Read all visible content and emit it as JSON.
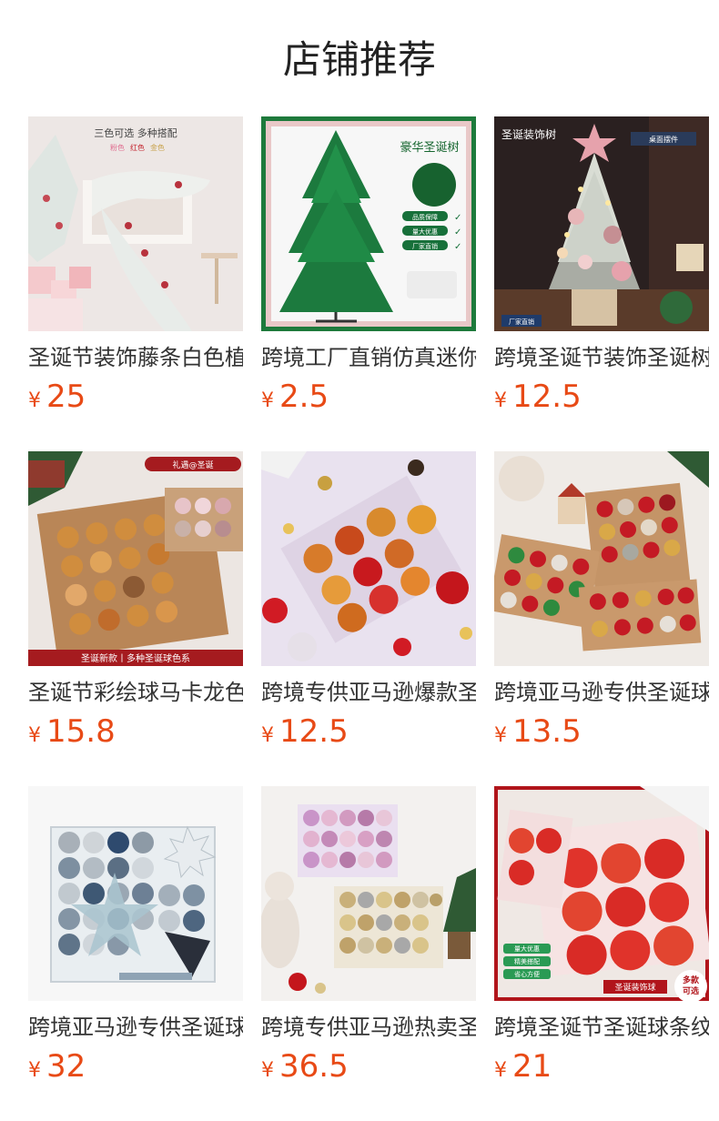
{
  "section_title": "店铺推荐",
  "currency_symbol": "¥",
  "products": [
    {
      "name": "圣诞节装饰藤条白色植绒",
      "price": "25",
      "image_tags": [
        "三色可选",
        "多种搭配",
        "粉色",
        "红色",
        "金色"
      ]
    },
    {
      "name": "跨境工厂直销仿真迷你圣诞树",
      "price": "2.5",
      "image_tags": [
        "豪华圣诞树",
        "品质保障",
        "量大优惠",
        "厂家直销"
      ]
    },
    {
      "name": "跨境圣诞节装饰圣诞树",
      "price": "12.5",
      "image_tags": [
        "圣诞装饰树",
        "桌面摆件",
        "厂家直销"
      ]
    },
    {
      "name": "圣诞节彩绘球马卡龙色",
      "price": "15.8",
      "image_tags": [
        "礼遇@圣诞",
        "圣诞新款丨多种圣诞球色系"
      ]
    },
    {
      "name": "跨境专供亚马逊爆款圣诞球",
      "price": "12.5",
      "image_tags": []
    },
    {
      "name": "跨境亚马逊专供圣诞球",
      "price": "13.5",
      "image_tags": []
    },
    {
      "name": "跨境亚马逊专供圣诞球套装",
      "price": "32",
      "image_tags": []
    },
    {
      "name": "跨境专供亚马逊热卖圣诞球",
      "price": "36.5",
      "image_tags": []
    },
    {
      "name": "跨境圣诞节圣诞球条纹",
      "price": "21",
      "image_tags": [
        "量大优惠",
        "精美搭配",
        "省心方便",
        "圣诞装饰球",
        "多款",
        "可选"
      ]
    }
  ],
  "colors": {
    "price": "#e84a16",
    "title": "#222222",
    "name": "#333333"
  }
}
